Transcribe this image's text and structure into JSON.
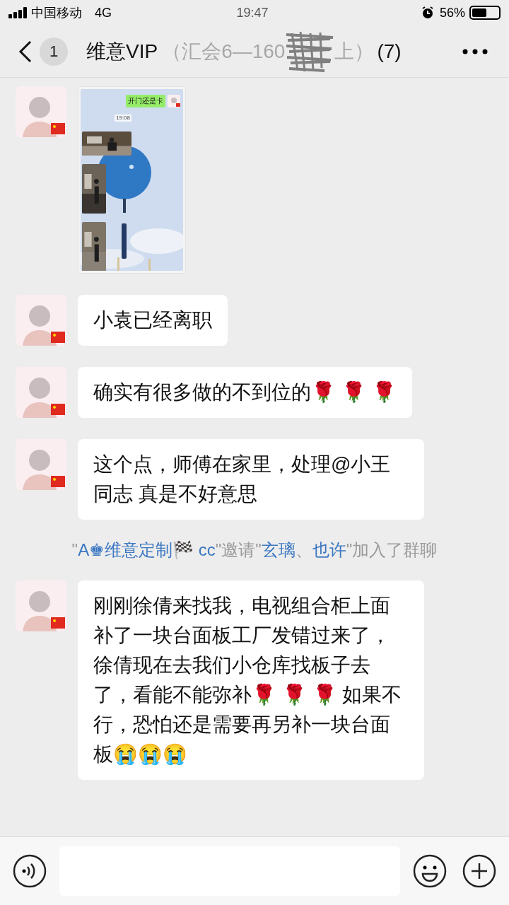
{
  "status_bar": {
    "carrier": "中国移动",
    "network": "4G",
    "time": "19:47",
    "battery": "56%"
  },
  "header": {
    "unread_count": "1",
    "title": "维意VIP",
    "title_faded": "（汇会6—160",
    "title_end": "上）",
    "member_count": "(7)"
  },
  "messages": [
    {
      "bubble_text": "开门还是卡",
      "time": "19:08"
    },
    {
      "kind": "text",
      "text": "小袁已经离职"
    },
    {
      "kind": "text",
      "text": "确实有很多做的不到位的🌹 🌹 🌹"
    },
    {
      "kind": "text",
      "text": "这个点，师傅在家里，处理@小王同志 真是不好意思"
    },
    {
      "kind": "system",
      "parts": [
        {
          "text": "\"",
          "link": false
        },
        {
          "text": "A♚维意定制🏁 cc",
          "link": true
        },
        {
          "text": "\"邀请\"",
          "link": false
        },
        {
          "text": "玄璃",
          "link": true
        },
        {
          "text": "、",
          "link": false
        },
        {
          "text": "也许",
          "link": true
        },
        {
          "text": "\"加入了群聊",
          "link": false
        }
      ]
    },
    {
      "kind": "text",
      "text": "刚刚徐倩来找我，电视组合柜上面补了一块台面板工厂发错过来了，徐倩现在去我们小仓库找板子去了，看能不能弥补🌹 🌹 🌹 如果不行，恐怕还是需要再另补一块台面板😭😭😭"
    }
  ]
}
